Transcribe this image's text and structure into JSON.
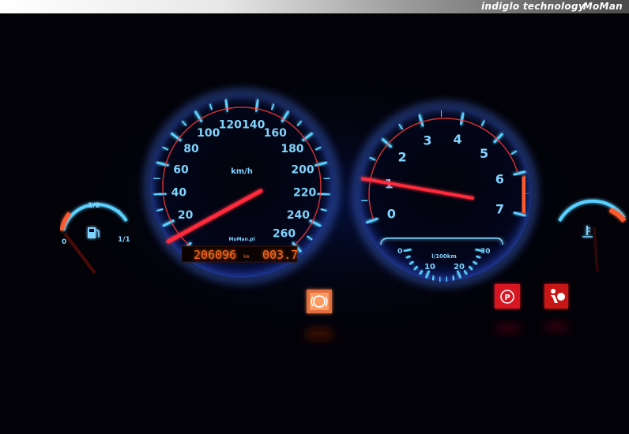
{
  "banner": {
    "title": "indiglo technology",
    "brand": "MoMan"
  },
  "speedometer": {
    "unit": "km/h",
    "labels": [
      "20",
      "40",
      "60",
      "80",
      "100",
      "120",
      "140",
      "160",
      "180",
      "200",
      "220",
      "240",
      "260"
    ],
    "brand": "MoMan.pl",
    "odometer": "206096",
    "odometer_unit": "km",
    "trip": "003.7",
    "needle_speed": 20
  },
  "tachometer": {
    "labels": [
      "0",
      "1",
      "2",
      "3",
      "4",
      "5",
      "6",
      "7"
    ],
    "needle_rpm": 1,
    "redline_color": "#ff5a2e",
    "economy": {
      "unit": "l/100km",
      "labels": [
        "0",
        "10",
        "20",
        "30"
      ]
    }
  },
  "fuel_gauge": {
    "labels": [
      "0",
      "1/2",
      "1/1"
    ],
    "icon": "fuel-pump-icon"
  },
  "temp_gauge": {
    "icon": "coolant-temp-icon"
  },
  "warning_lights": [
    "brake-warning-icon",
    "parking-brake-icon",
    "airbag-icon"
  ],
  "colors": {
    "backlight": "#5ad0ff",
    "needle": "#ff2a3a",
    "lcd": "#ff6a1a"
  }
}
